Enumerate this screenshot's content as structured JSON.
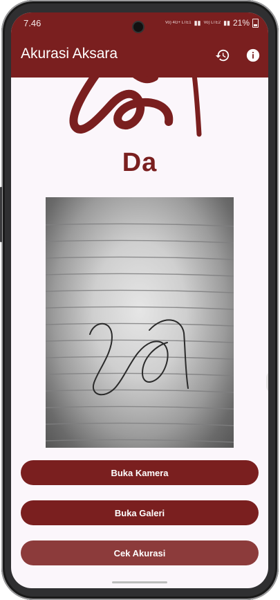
{
  "status_bar": {
    "time": "7.46",
    "network_left": "Vo) 4G+ LTE1",
    "network_right": "Vo) LTE2",
    "battery": "21%"
  },
  "app_bar": {
    "title": "Akurasi Aksara",
    "actions": [
      {
        "icon": "history-icon"
      },
      {
        "icon": "info-icon"
      }
    ]
  },
  "aksara": {
    "letter": "Da"
  },
  "buttons": {
    "open_camera": "Buka Kamera",
    "open_gallery": "Buka Galeri",
    "check_accuracy": "Cek Akurasi"
  },
  "colors": {
    "primary": "#7a1f1f",
    "primary_light": "#8c3b3b",
    "background": "#fbf6fb"
  }
}
